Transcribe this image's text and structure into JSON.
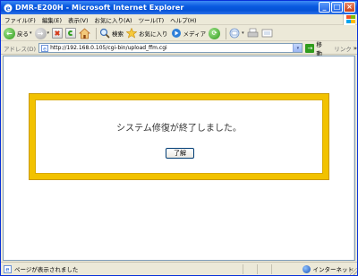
{
  "window": {
    "title": "DMR-E200H - Microsoft Internet Explorer",
    "buttons": {
      "minimize": "_",
      "maximize": "□",
      "close": "×"
    }
  },
  "menu": {
    "items": [
      {
        "label": "ファイル(F)"
      },
      {
        "label": "編集(E)"
      },
      {
        "label": "表示(V)"
      },
      {
        "label": "お気に入り(A)"
      },
      {
        "label": "ツール(T)"
      },
      {
        "label": "ヘルプ(H)"
      }
    ]
  },
  "toolbar": {
    "back_label": "戻る",
    "dropdown_arrow": "▾",
    "back_icon": "back-arrow-icon",
    "forward_icon": "forward-arrow-icon",
    "search_label": "検索",
    "favorites_label": "お気に入り",
    "media_label": "メディア"
  },
  "address": {
    "label": "アドレス(D)",
    "url": "http://192.168.0.105/cgi-bin/upload_ffm.cgi",
    "go_label": "移動",
    "links_label": "リンク",
    "links_arrow": "»"
  },
  "dialog": {
    "message": "システム修復が終了しました。",
    "ok_label": "了解",
    "border_color": "#f2c200"
  },
  "status": {
    "text": "ページが表示されました",
    "zone": "インターネット"
  }
}
